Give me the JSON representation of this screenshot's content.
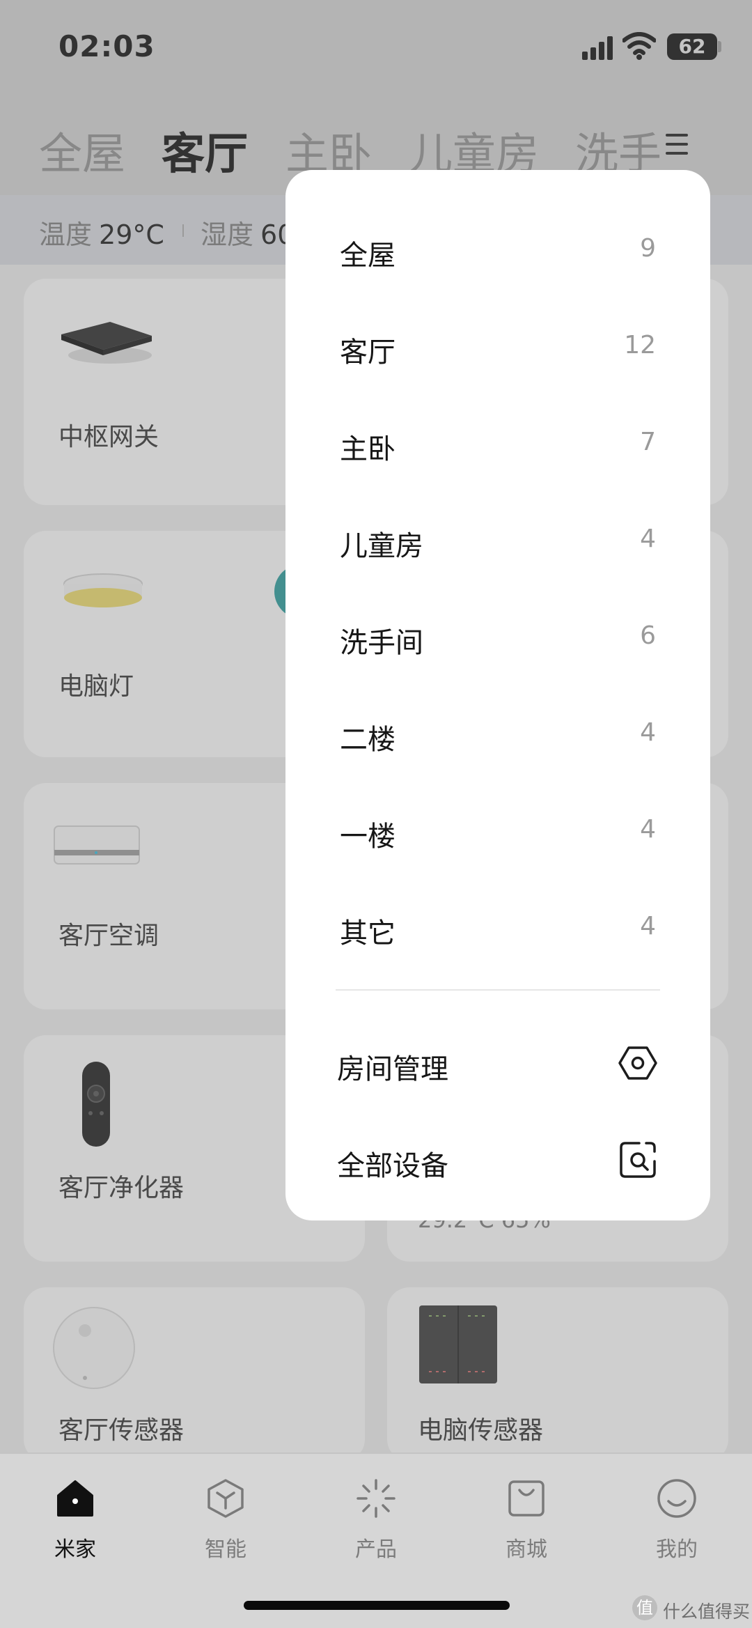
{
  "status_bar": {
    "time": "02:03",
    "battery": "62"
  },
  "room_tabs": [
    {
      "label": "全屋",
      "active": false
    },
    {
      "label": "客厅",
      "active": true
    },
    {
      "label": "主卧",
      "active": false
    },
    {
      "label": "儿童房",
      "active": false
    },
    {
      "label": "洗手",
      "active": false
    }
  ],
  "environment": {
    "temperature_label": "温度",
    "temperature_value": "29°C",
    "humidity_label": "湿度",
    "humidity_value": "60"
  },
  "devices": [
    {
      "name": "中枢网关"
    },
    {
      "name": "电脑灯"
    },
    {
      "name": "客厅空调"
    },
    {
      "name": "客厅净化器"
    },
    {
      "name": "客厅传感器"
    },
    {
      "name": "电脑传感器"
    }
  ],
  "partial_readout": "29.2°C 65%",
  "room_menu": {
    "rooms": [
      {
        "label": "全屋",
        "count": "9"
      },
      {
        "label": "客厅",
        "count": "12"
      },
      {
        "label": "主卧",
        "count": "7"
      },
      {
        "label": "儿童房",
        "count": "4"
      },
      {
        "label": "洗手间",
        "count": "6"
      },
      {
        "label": "二楼",
        "count": "4"
      },
      {
        "label": "一楼",
        "count": "4"
      },
      {
        "label": "其它",
        "count": "4"
      }
    ],
    "actions": [
      {
        "label": "房间管理",
        "icon": "hexagon-settings-icon"
      },
      {
        "label": "全部设备",
        "icon": "device-search-icon"
      }
    ]
  },
  "bottom_nav": [
    {
      "label": "米家",
      "icon": "home-icon",
      "active": true
    },
    {
      "label": "智能",
      "icon": "cube-icon",
      "active": false
    },
    {
      "label": "产品",
      "icon": "sparkle-icon",
      "active": false
    },
    {
      "label": "商城",
      "icon": "shopping-bag-icon",
      "active": false
    },
    {
      "label": "我的",
      "icon": "smile-icon",
      "active": false
    }
  ],
  "watermark": {
    "badge": "值",
    "text": "什么值得买"
  },
  "colors": {
    "accent_teal": "#2a9a9a",
    "scrim": "#787878",
    "menu_bg": "#ffffff"
  }
}
